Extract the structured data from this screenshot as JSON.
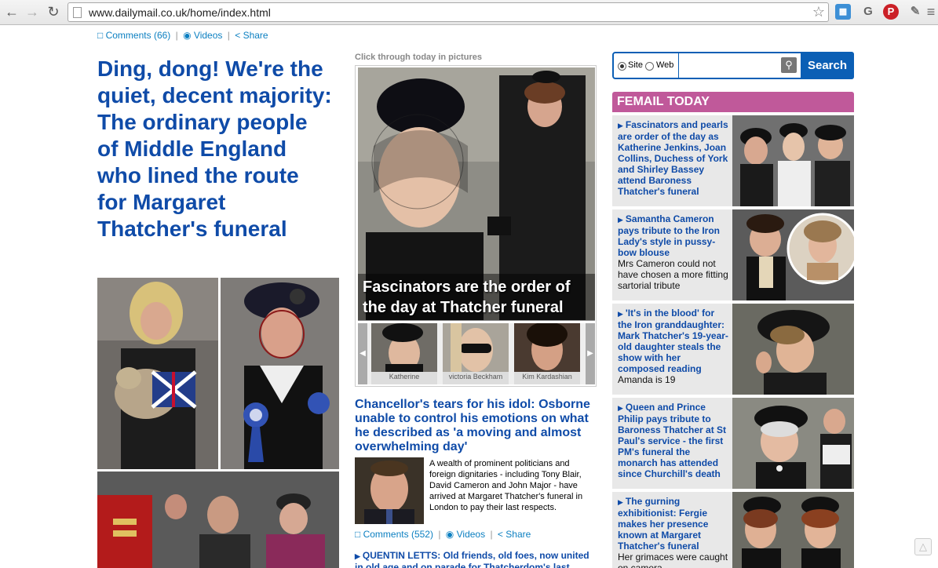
{
  "browser": {
    "url": "www.dailymail.co.uk/home/index.html",
    "back_icon": "back-arrow-icon",
    "forward_icon": "forward-arrow-icon",
    "reload_icon": "reload-icon"
  },
  "top_meta": {
    "comments": "Comments (66)",
    "videos": "Videos",
    "share": "Share"
  },
  "lead": {
    "headline": "Ding, dong! We're the quiet, decent majority: The ordinary people of Middle England who lined the route for Margaret Thatcher's funeral"
  },
  "gallery": {
    "label": "Click through today in pictures",
    "caption": "Fascinators are the order of the day at Thatcher funeral",
    "thumbs": [
      "Katherine",
      "victoria Beckham",
      "Kim Kardashian"
    ]
  },
  "story": {
    "headline": "Chancellor's tears for his idol: Osborne unable to control his emotions on what he described as 'a moving and almost overwhelming day'",
    "body": "A wealth of prominent politicians and foreign dignitaries - including Tony Blair, David Cameron and John Major - have arrived at Margaret Thatcher's funeral in London to pay their last respects.",
    "comments": "Comments (552)",
    "videos": "Videos",
    "share": "Share",
    "bullet": "QUENTIN LETTS: Old friends, old foes, now united in old age and on parade for Thatcherdom's last hurrah"
  },
  "search": {
    "option_site": "Site",
    "option_web": "Web",
    "button": "Search",
    "value": ""
  },
  "femail": {
    "title": "FEMAIL TODAY",
    "items": [
      {
        "link": "Fascinators and pearls are order of the day as Katherine Jenkins, Joan Collins, Duchess of York and Shirley Bassey attend Baroness Thatcher's funeral",
        "desc": ""
      },
      {
        "link": "Samantha Cameron pays tribute to the Iron Lady's style in pussy-bow blouse",
        "desc": "Mrs Cameron could not have chosen a more fitting sartorial tribute"
      },
      {
        "link": "'It's in the blood' for the Iron granddaughter: Mark Thatcher's 19-year-old daughter steals the show with her composed reading",
        "desc": "Amanda is 19"
      },
      {
        "link": "Queen and Prince Philip pays tribute to Baroness Thatcher at St Paul's service - the first PM's funeral the monarch has attended since Churchill's death",
        "desc": ""
      },
      {
        "link": "The gurning exhibitionist: Fergie makes her presence known at Margaret Thatcher's funeral",
        "desc": "Her grimaces were caught on camera"
      }
    ]
  },
  "colors": {
    "link_blue": "#0f4ba8",
    "meta_blue": "#0b7fc1",
    "femail_pink": "#c0599a",
    "search_blue": "#0b5fb5"
  }
}
